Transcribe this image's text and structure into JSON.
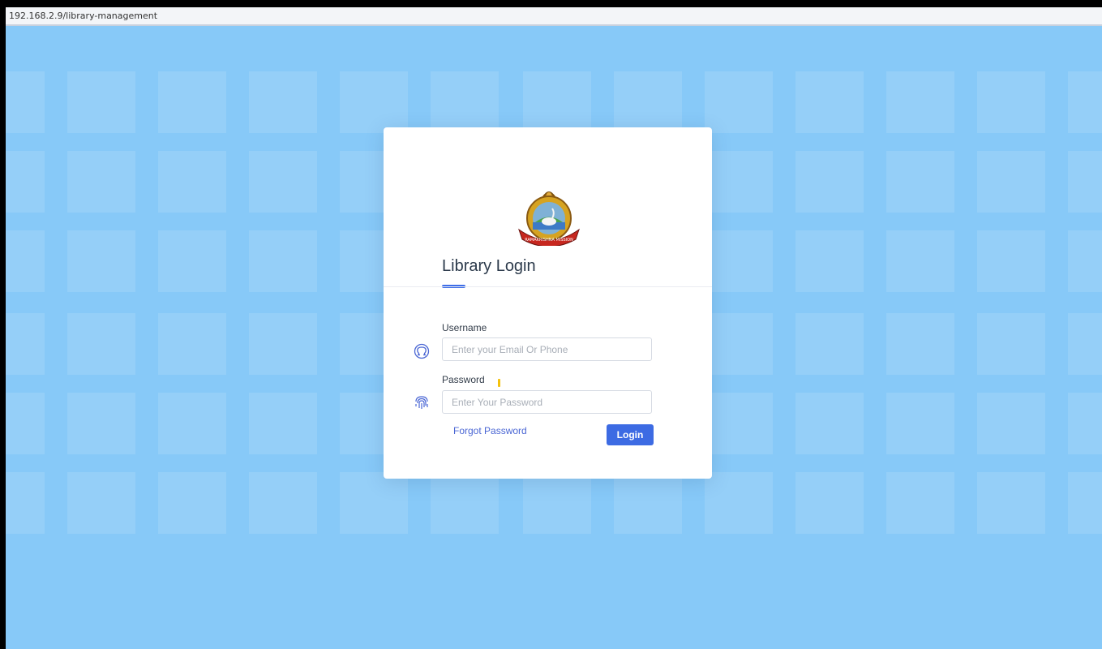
{
  "browser": {
    "url": "192.168.2.9/library-management"
  },
  "login": {
    "title": "Library Login",
    "username_label": "Username",
    "username_placeholder": "Enter your Email Or Phone",
    "username_value": "",
    "password_label": "Password",
    "password_placeholder": "Enter Your Password",
    "password_value": "",
    "forgot_label": "Forgot Password",
    "login_button": "Login"
  },
  "icons": {
    "username": "user-circle-icon",
    "password": "fingerprint-icon",
    "logo": "ramakrishna-mission-emblem"
  },
  "colors": {
    "background": "#87c9f8",
    "accent": "#3d6be3",
    "link": "#4a66d4"
  }
}
